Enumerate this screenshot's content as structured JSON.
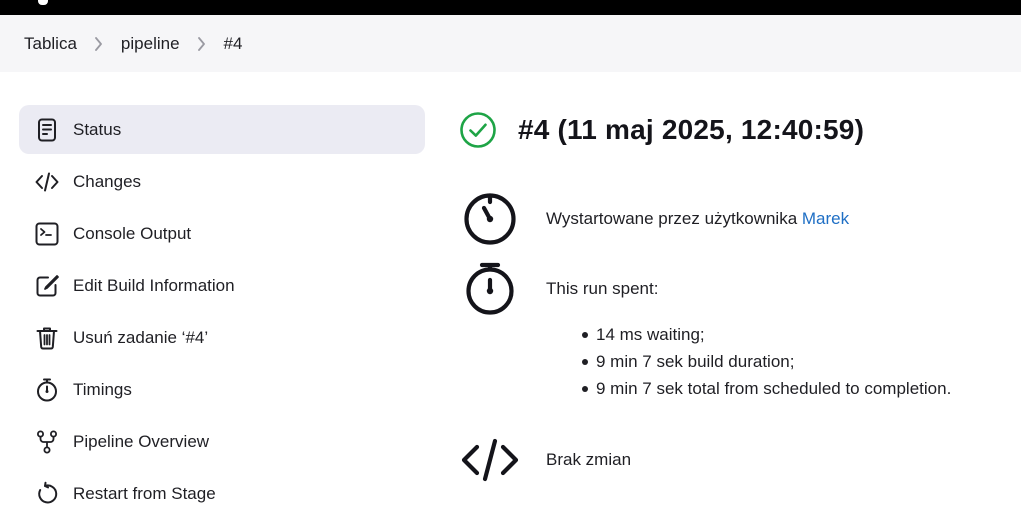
{
  "breadcrumb": [
    "Tablica",
    "pipeline",
    "#4"
  ],
  "sidebar": {
    "items": [
      {
        "label": "Status",
        "icon": "document-icon",
        "active": true
      },
      {
        "label": "Changes",
        "icon": "code-icon"
      },
      {
        "label": "Console Output",
        "icon": "terminal-icon"
      },
      {
        "label": "Edit Build Information",
        "icon": "edit-icon"
      },
      {
        "label": "Usuń zadanie ‘#4’",
        "icon": "trash-icon"
      },
      {
        "label": "Timings",
        "icon": "stopwatch-icon"
      },
      {
        "label": "Pipeline Overview",
        "icon": "branch-icon"
      },
      {
        "label": "Restart from Stage",
        "icon": "restart-icon"
      }
    ]
  },
  "main": {
    "title": "#4 (11 maj 2025, 12:40:59)",
    "status": "success",
    "status_color": "#1ea446",
    "started_by_prefix": "Wystartowane przez użytkownika ",
    "started_by_user": "Marek",
    "run_spent_label": "This run spent:",
    "timings": [
      "14 ms waiting;",
      "9 min 7 sek build duration;",
      "9 min 7 sek total from scheduled to completion."
    ],
    "changes_text": "Brak zmian"
  }
}
